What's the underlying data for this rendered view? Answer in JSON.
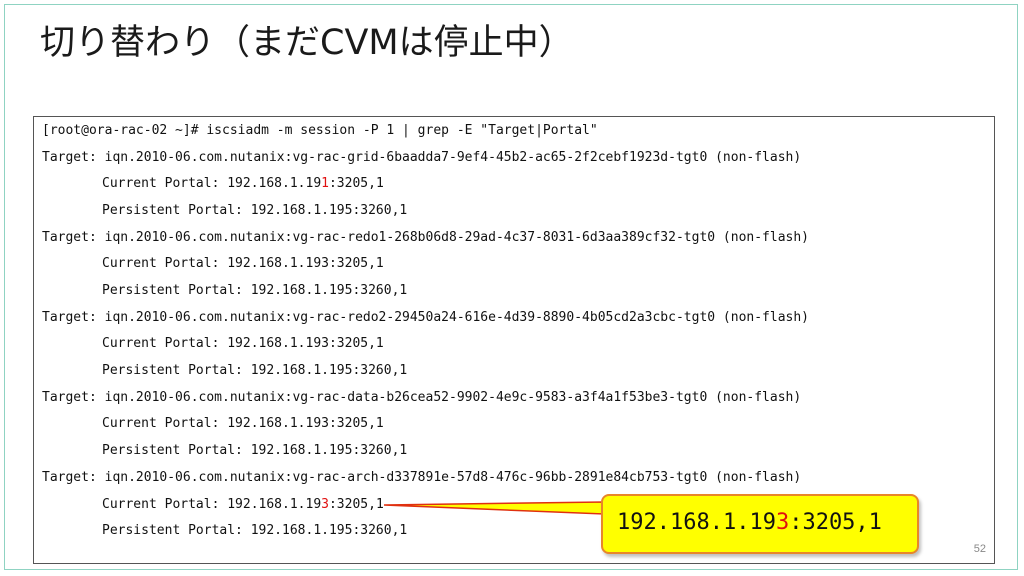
{
  "slide": {
    "title": "切り替わり（まだCVMは停止中）",
    "page_number": "52"
  },
  "terminal": {
    "command": "[root@ora-rac-02 ~]# iscsiadm -m session -P 1 | grep -E \"Target|Portal\"",
    "targets": [
      {
        "target": "Target: iqn.2010-06.com.nutanix:vg-rac-grid-6baadda7-9ef4-45b2-ac65-2f2cebf1923d-tgt0 (non-flash)",
        "current_prefix": "Current Portal: 192.168.1.19",
        "current_highlight": "1",
        "current_suffix": ":3205,1",
        "persistent": "Persistent Portal: 192.168.1.195:3260,1"
      },
      {
        "target": "Target: iqn.2010-06.com.nutanix:vg-rac-redo1-268b06d8-29ad-4c37-8031-6d3aa389cf32-tgt0 (non-flash)",
        "current": "Current Portal: 192.168.1.193:3205,1",
        "persistent": "Persistent Portal: 192.168.1.195:3260,1"
      },
      {
        "target": "Target: iqn.2010-06.com.nutanix:vg-rac-redo2-29450a24-616e-4d39-8890-4b05cd2a3cbc-tgt0 (non-flash)",
        "current": "Current Portal: 192.168.1.193:3205,1",
        "persistent": "Persistent Portal: 192.168.1.195:3260,1"
      },
      {
        "target": "Target: iqn.2010-06.com.nutanix:vg-rac-data-b26cea52-9902-4e9c-9583-a3f4a1f53be3-tgt0 (non-flash)",
        "current": "Current Portal: 192.168.1.193:3205,1",
        "persistent": "Persistent Portal: 192.168.1.195:3260,1"
      },
      {
        "target": "Target: iqn.2010-06.com.nutanix:vg-rac-arch-d337891e-57d8-476c-96bb-2891e84cb753-tgt0 (non-flash)",
        "current_prefix": "Current Portal: 192.168.1.19",
        "current_highlight": "3",
        "current_suffix": ":3205,1",
        "persistent": "Persistent Portal: 192.168.1.195:3260,1"
      }
    ]
  },
  "callout": {
    "prefix": "192.168.1.19",
    "highlight": "3",
    "suffix": ":3205,1"
  },
  "colors": {
    "highlight": "#e01010",
    "callout_fill": "#ffff00",
    "callout_border": "#e8862a",
    "frame": "#8fd3c2"
  }
}
